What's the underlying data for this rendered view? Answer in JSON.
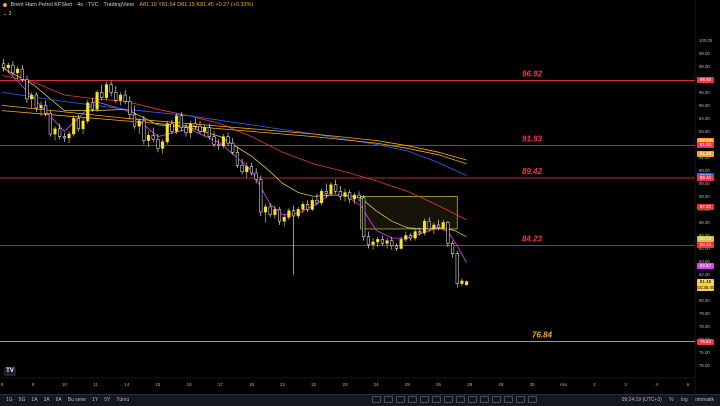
{
  "header": {
    "title": "Brent Ham Petrol KFSleri · 4s · TVC · TradingView",
    "ohlc": "A81.19 Y81.54 D81.15 K81.45 +0.27 (+0.33%)",
    "collapse_label": "3"
  },
  "logo_text": "TV",
  "colors": {
    "up": "#f7e12b",
    "down": "#ffffff",
    "ema_fast": "#e040fb",
    "ema_mid": "#d4c44a",
    "ema_red": "#e53935",
    "ema_blue": "#2962ff",
    "ema_orange": "#f5a623",
    "hline": "#f23645",
    "zone": "#d4c44a",
    "label": "#f23645",
    "label_bottom": "#f5a623"
  },
  "chart_data": {
    "type": "candlestick",
    "ylim": [
      74.5,
      100.8
    ],
    "y_ticks": [
      "100.00",
      "99.00",
      "98.00",
      "97.00",
      "96.00",
      "95.00",
      "94.00",
      "93.00",
      "92.00",
      "91.00",
      "90.00",
      "89.00",
      "88.00",
      "87.00",
      "86.00",
      "85.00",
      "84.00",
      "83.00",
      "82.00",
      "81.00",
      "80.00",
      "79.00",
      "78.00",
      "77.00",
      "76.00",
      "75.00"
    ],
    "y_tick_values": [
      100,
      99,
      98,
      97,
      96,
      95,
      94,
      93,
      92,
      91,
      90,
      89,
      88,
      87,
      86,
      85,
      84,
      83,
      82,
      81,
      80,
      79,
      78,
      77,
      76,
      75
    ],
    "x_ticks": [
      "8",
      "9",
      "10",
      "11",
      "14",
      "15",
      "16",
      "17",
      "18",
      "21",
      "22",
      "23",
      "24",
      "25",
      "26",
      "28",
      "29",
      "30",
      "Ara",
      "2",
      "3",
      "4",
      "6"
    ],
    "x_tick_values": [
      0,
      1,
      2,
      3,
      4,
      5,
      6,
      7,
      8,
      9,
      10,
      11,
      12,
      13,
      14,
      15,
      16,
      17,
      18,
      19,
      20,
      21,
      22
    ],
    "x_range": [
      0,
      22
    ],
    "levels": [
      {
        "price": 96.92,
        "label": "96.92",
        "color": "#f23645"
      },
      {
        "price": 91.93,
        "label": "91.93",
        "color": "#f23645"
      },
      {
        "price": 89.42,
        "label": "89.42",
        "color": "#f23645"
      },
      {
        "price": 84.23,
        "label": "84.23",
        "color": "#f23645"
      },
      {
        "price": 76.84,
        "label": "76.84",
        "color": "#f5a623"
      }
    ],
    "zone": {
      "x0": 11.5,
      "x1": 14.6,
      "y0": 85.5,
      "y1": 88.0
    },
    "candles": [
      [
        0.05,
        98.2,
        98.6,
        97.6,
        97.9
      ],
      [
        0.2,
        97.9,
        98.3,
        97.5,
        98.1
      ],
      [
        0.35,
        98.1,
        98.4,
        97.3,
        97.5
      ],
      [
        0.5,
        97.5,
        98.0,
        97.0,
        97.8
      ],
      [
        0.65,
        97.8,
        98.1,
        96.8,
        97.0
      ],
      [
        0.8,
        97.0,
        97.3,
        95.2,
        95.5
      ],
      [
        0.95,
        95.5,
        96.0,
        94.8,
        95.8
      ],
      [
        1.1,
        95.8,
        96.0,
        94.5,
        94.8
      ],
      [
        1.25,
        94.8,
        95.3,
        94.2,
        95.0
      ],
      [
        1.4,
        95.0,
        95.4,
        94.2,
        94.4
      ],
      [
        1.55,
        94.4,
        94.6,
        92.6,
        92.8
      ],
      [
        1.7,
        92.8,
        93.4,
        92.3,
        93.2
      ],
      [
        1.85,
        93.2,
        93.6,
        92.4,
        92.6
      ],
      [
        2.0,
        92.6,
        92.9,
        92.2,
        92.5
      ],
      [
        2.15,
        92.5,
        93.0,
        92.1,
        92.8
      ],
      [
        2.3,
        92.8,
        94.2,
        92.6,
        94.0
      ],
      [
        2.45,
        94.0,
        94.3,
        93.0,
        93.2
      ],
      [
        2.6,
        93.2,
        94.0,
        92.8,
        93.8
      ],
      [
        2.75,
        93.8,
        95.4,
        93.6,
        95.2
      ],
      [
        2.9,
        95.2,
        95.6,
        94.5,
        94.7
      ],
      [
        3.05,
        94.7,
        96.2,
        94.5,
        96.0
      ],
      [
        3.2,
        96.0,
        96.6,
        95.4,
        95.6
      ],
      [
        3.35,
        95.6,
        96.8,
        95.4,
        96.6
      ],
      [
        3.5,
        96.6,
        96.9,
        95.7,
        96.0
      ],
      [
        3.65,
        96.0,
        96.5,
        95.2,
        95.4
      ],
      [
        3.8,
        95.4,
        96.0,
        95.0,
        95.8
      ],
      [
        3.95,
        95.8,
        96.2,
        95.1,
        95.3
      ],
      [
        4.1,
        95.3,
        95.7,
        94.0,
        94.3
      ],
      [
        4.25,
        94.3,
        95.0,
        93.2,
        93.4
      ],
      [
        4.4,
        93.4,
        94.0,
        92.8,
        93.8
      ],
      [
        4.55,
        93.8,
        94.2,
        92.0,
        92.3
      ],
      [
        4.7,
        92.3,
        93.0,
        91.8,
        92.7
      ],
      [
        4.85,
        92.7,
        93.3,
        92.2,
        92.4
      ],
      [
        5.0,
        92.4,
        92.8,
        91.4,
        91.7
      ],
      [
        5.15,
        91.7,
        92.4,
        91.3,
        92.2
      ],
      [
        5.3,
        92.2,
        93.8,
        92.0,
        93.6
      ],
      [
        5.45,
        93.6,
        93.9,
        92.8,
        93.0
      ],
      [
        5.6,
        93.0,
        94.4,
        92.8,
        94.2
      ],
      [
        5.75,
        94.2,
        94.5,
        93.0,
        93.3
      ],
      [
        5.9,
        93.3,
        93.6,
        92.6,
        92.9
      ],
      [
        6.05,
        92.9,
        93.8,
        92.5,
        93.6
      ],
      [
        6.2,
        93.6,
        94.0,
        93.2,
        93.4
      ],
      [
        6.35,
        93.4,
        93.8,
        92.8,
        93.0
      ],
      [
        6.5,
        93.0,
        93.5,
        92.6,
        93.3
      ],
      [
        6.65,
        93.3,
        93.6,
        92.4,
        92.6
      ],
      [
        6.8,
        92.6,
        93.0,
        91.8,
        92.0
      ],
      [
        6.95,
        92.0,
        92.4,
        91.6,
        91.9
      ],
      [
        7.1,
        91.9,
        92.8,
        91.7,
        92.6
      ],
      [
        7.25,
        92.6,
        92.9,
        91.9,
        92.1
      ],
      [
        7.4,
        92.1,
        92.5,
        91.2,
        91.4
      ],
      [
        7.55,
        91.4,
        91.8,
        90.2,
        90.4
      ],
      [
        7.7,
        90.4,
        90.9,
        89.7,
        89.9
      ],
      [
        7.85,
        89.9,
        90.6,
        89.4,
        90.3
      ],
      [
        8.0,
        90.3,
        90.6,
        89.6,
        89.8
      ],
      [
        8.15,
        89.8,
        90.2,
        89.0,
        89.3
      ],
      [
        8.3,
        89.3,
        89.6,
        86.5,
        86.8
      ],
      [
        8.45,
        86.8,
        87.4,
        86.0,
        87.2
      ],
      [
        8.6,
        87.2,
        87.5,
        86.4,
        86.6
      ],
      [
        8.75,
        86.6,
        87.3,
        86.3,
        87.0
      ],
      [
        8.9,
        87.0,
        87.2,
        85.8,
        86.1
      ],
      [
        9.05,
        86.1,
        86.6,
        85.7,
        86.4
      ],
      [
        9.2,
        86.4,
        87.1,
        86.2,
        86.9
      ],
      [
        9.35,
        86.9,
        87.3,
        82.0,
        86.5
      ],
      [
        9.5,
        86.5,
        87.2,
        86.3,
        87.0
      ],
      [
        9.65,
        87.0,
        87.6,
        86.7,
        87.4
      ],
      [
        9.8,
        87.4,
        87.7,
        86.8,
        87.0
      ],
      [
        9.95,
        87.0,
        87.9,
        86.9,
        87.7
      ],
      [
        10.1,
        87.7,
        88.2,
        87.3,
        87.5
      ],
      [
        10.25,
        87.5,
        88.6,
        87.3,
        88.4
      ],
      [
        10.4,
        88.4,
        89.0,
        87.9,
        88.2
      ],
      [
        10.55,
        88.2,
        89.1,
        88.0,
        88.9
      ],
      [
        10.7,
        88.9,
        89.3,
        88.2,
        88.4
      ],
      [
        10.85,
        88.4,
        88.8,
        87.7,
        88.0
      ],
      [
        11.0,
        88.0,
        88.6,
        87.6,
        88.3
      ],
      [
        11.15,
        88.3,
        88.5,
        87.5,
        87.8
      ],
      [
        11.3,
        87.8,
        88.3,
        87.4,
        88.1
      ],
      [
        11.45,
        88.1,
        88.4,
        87.6,
        87.9
      ],
      [
        11.6,
        87.9,
        88.1,
        84.6,
        84.9
      ],
      [
        11.75,
        84.9,
        85.3,
        84.0,
        84.3
      ],
      [
        11.9,
        84.3,
        84.8,
        83.9,
        84.5
      ],
      [
        12.05,
        84.5,
        84.9,
        84.1,
        84.7
      ],
      [
        12.2,
        84.7,
        85.0,
        84.2,
        84.4
      ],
      [
        12.35,
        84.4,
        84.8,
        84.0,
        84.6
      ],
      [
        12.5,
        84.6,
        84.9,
        83.9,
        84.2
      ],
      [
        12.65,
        84.2,
        84.4,
        83.8,
        84.0
      ],
      [
        12.8,
        84.0,
        84.9,
        83.9,
        84.7
      ],
      [
        12.95,
        84.7,
        85.3,
        84.5,
        85.0
      ],
      [
        13.1,
        85.0,
        85.2,
        84.6,
        84.8
      ],
      [
        13.25,
        84.8,
        85.5,
        84.6,
        85.3
      ],
      [
        13.4,
        85.3,
        85.6,
        85.0,
        85.2
      ],
      [
        13.55,
        85.2,
        86.3,
        85.0,
        86.1
      ],
      [
        13.7,
        86.1,
        86.4,
        85.3,
        85.5
      ],
      [
        13.85,
        85.5,
        86.0,
        85.1,
        85.8
      ],
      [
        14.0,
        85.8,
        86.2,
        85.4,
        85.6
      ],
      [
        14.15,
        85.6,
        86.2,
        85.5,
        86.0
      ],
      [
        14.3,
        86.0,
        86.1,
        84.1,
        84.4
      ],
      [
        14.45,
        84.4,
        84.6,
        83.3,
        83.6
      ],
      [
        14.6,
        83.6,
        83.8,
        81.0,
        81.3
      ],
      [
        14.75,
        81.3,
        81.7,
        81.1,
        81.5
      ],
      [
        14.9,
        81.2,
        81.54,
        81.15,
        81.45
      ]
    ],
    "emas": [
      {
        "name": "fast",
        "color": "#e040fb",
        "points": [
          [
            0,
            98.1
          ],
          [
            1,
            95.6
          ],
          [
            2,
            93.0
          ],
          [
            3,
            95.3
          ],
          [
            4,
            94.6
          ],
          [
            5,
            92.6
          ],
          [
            6,
            93.2
          ],
          [
            7,
            92.1
          ],
          [
            8,
            90.0
          ],
          [
            8.6,
            87.4
          ],
          [
            9,
            86.6
          ],
          [
            9.5,
            86.7
          ],
          [
            10,
            87.3
          ],
          [
            10.5,
            88.1
          ],
          [
            11,
            88.1
          ],
          [
            11.5,
            87.3
          ],
          [
            12,
            85.4
          ],
          [
            12.5,
            84.8
          ],
          [
            13,
            84.8
          ],
          [
            13.5,
            85.2
          ],
          [
            14,
            85.6
          ],
          [
            14.3,
            85.3
          ],
          [
            14.6,
            84.2
          ],
          [
            14.9,
            82.9
          ]
        ]
      },
      {
        "name": "mid",
        "color": "#d4c44a",
        "points": [
          [
            0,
            97.9
          ],
          [
            1,
            96.6
          ],
          [
            2,
            94.6
          ],
          [
            3,
            94.6
          ],
          [
            4,
            94.7
          ],
          [
            5,
            93.5
          ],
          [
            6,
            93.3
          ],
          [
            7,
            92.6
          ],
          [
            8,
            91.1
          ],
          [
            8.6,
            89.9
          ],
          [
            9,
            89.0
          ],
          [
            9.5,
            88.3
          ],
          [
            10,
            88.0
          ],
          [
            10.5,
            88.1
          ],
          [
            11,
            88.1
          ],
          [
            11.5,
            87.9
          ],
          [
            12,
            86.9
          ],
          [
            12.5,
            86.1
          ],
          [
            13,
            85.6
          ],
          [
            13.5,
            85.5
          ],
          [
            14,
            85.6
          ],
          [
            14.5,
            85.4
          ],
          [
            14.9,
            84.9
          ]
        ]
      },
      {
        "name": "red",
        "color": "#e53935",
        "points": [
          [
            0,
            97.3
          ],
          [
            1,
            96.8
          ],
          [
            2,
            95.8
          ],
          [
            3,
            95.5
          ],
          [
            4,
            95.3
          ],
          [
            5,
            94.7
          ],
          [
            6,
            94.2
          ],
          [
            7,
            93.6
          ],
          [
            8,
            92.6
          ],
          [
            9,
            91.4
          ],
          [
            10,
            90.5
          ],
          [
            11,
            89.9
          ],
          [
            12,
            89.2
          ],
          [
            13,
            88.4
          ],
          [
            14,
            87.3
          ],
          [
            14.9,
            86.2
          ]
        ]
      },
      {
        "name": "blue",
        "color": "#2962ff",
        "points": [
          [
            0,
            96.0
          ],
          [
            2,
            95.3
          ],
          [
            4,
            94.7
          ],
          [
            6,
            94.2
          ],
          [
            8,
            93.5
          ],
          [
            10,
            92.8
          ],
          [
            12,
            92.0
          ],
          [
            13,
            91.5
          ],
          [
            14,
            90.6
          ],
          [
            14.9,
            89.6
          ]
        ]
      },
      {
        "name": "orange",
        "color": "#f5a623",
        "points": [
          [
            0,
            95.0
          ],
          [
            2,
            94.5
          ],
          [
            4,
            94.0
          ],
          [
            6,
            93.6
          ],
          [
            8,
            93.2
          ],
          [
            10,
            92.8
          ],
          [
            12,
            92.3
          ],
          [
            13,
            91.9
          ],
          [
            14,
            91.4
          ],
          [
            14.9,
            90.8
          ]
        ]
      },
      {
        "name": "orange2",
        "color": "#f5a623",
        "points": [
          [
            0,
            94.6
          ],
          [
            2,
            94.2
          ],
          [
            4,
            93.8
          ],
          [
            6,
            93.4
          ],
          [
            8,
            93.0
          ],
          [
            10,
            92.6
          ],
          [
            12,
            92.1
          ],
          [
            13,
            91.7
          ],
          [
            14,
            91.2
          ],
          [
            14.9,
            90.5
          ]
        ]
      }
    ],
    "price_badges": [
      {
        "price": 96.92,
        "label": "96.92",
        "color": "#f23645"
      },
      {
        "price": 92.23,
        "label": "92.23",
        "color": "#f5a623"
      },
      {
        "price": 91.93,
        "label": "91.93",
        "color": "#f23645"
      },
      {
        "price": 91.28,
        "label": "91.28",
        "color": "#f5a623"
      },
      {
        "price": 89.55,
        "label": "89.55",
        "color": "#2962ff"
      },
      {
        "price": 89.42,
        "label": "89.42",
        "color": "#f23645"
      },
      {
        "price": 87.21,
        "label": "87.21",
        "color": "#e53935"
      },
      {
        "price": 84.74,
        "label": "84.74",
        "color": "#d4c44a"
      },
      {
        "price": 84.23,
        "label": "84.23",
        "color": "#f23645"
      },
      {
        "price": 82.67,
        "label": "82.67",
        "color": "#e040fb"
      },
      {
        "price": 76.84,
        "label": "76.84",
        "color": "#f23645"
      }
    ],
    "current": {
      "price": 81.45,
      "label": "81.45",
      "countdown": "03:35:40"
    }
  },
  "bottom": {
    "ranges": [
      "1G",
      "5G",
      "1A",
      "3A",
      "6A",
      "Bu sene",
      "1Y",
      "5Y",
      "Tümü"
    ],
    "time": "09:24:19 (UTC+3)",
    "pct": "%",
    "log": "log",
    "auto": "otomatik"
  }
}
